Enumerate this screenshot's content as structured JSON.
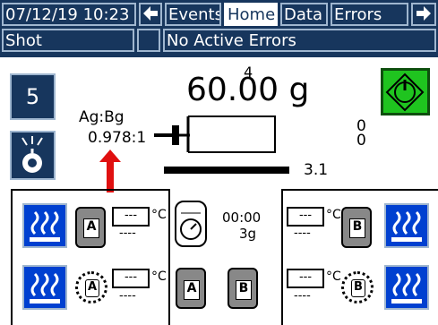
{
  "header": {
    "datetime": "07/12/19 10:23",
    "tabs": [
      "Events",
      "Home",
      "Data",
      "Errors"
    ],
    "active_tab": "Home",
    "mode": "Shot",
    "status": "No Active Errors"
  },
  "shot": {
    "number_top": "4",
    "weight": "60.00 g",
    "shot_button": "5",
    "ratio_label": "Ag:Bg",
    "ratio_value": "0.978:1",
    "right_readout_top": "0",
    "right_readout_bottom": "0",
    "bar_value": "3.1"
  },
  "center": {
    "timer": "00:00",
    "grams": "3g"
  },
  "left": {
    "tank_a_label": "A",
    "pump_a_label": "A",
    "temp_value": "---",
    "temp_unit": "°C",
    "temp_sub": "----"
  },
  "right": {
    "tank_b_label": "B",
    "pump_b_label": "B",
    "temp_value": "---",
    "temp_unit": "°C",
    "temp_sub": "----"
  },
  "colors": {
    "header_bg": "#17365d",
    "start_green": "#1fc41f",
    "heat_blue": "#0040d0",
    "arrow_red": "#e01010"
  },
  "icons": [
    "back-arrow-icon",
    "forward-arrow-icon",
    "start-icon",
    "spray-gun-icon",
    "heater-icon",
    "tank-icon",
    "pump-icon",
    "timer-icon"
  ]
}
